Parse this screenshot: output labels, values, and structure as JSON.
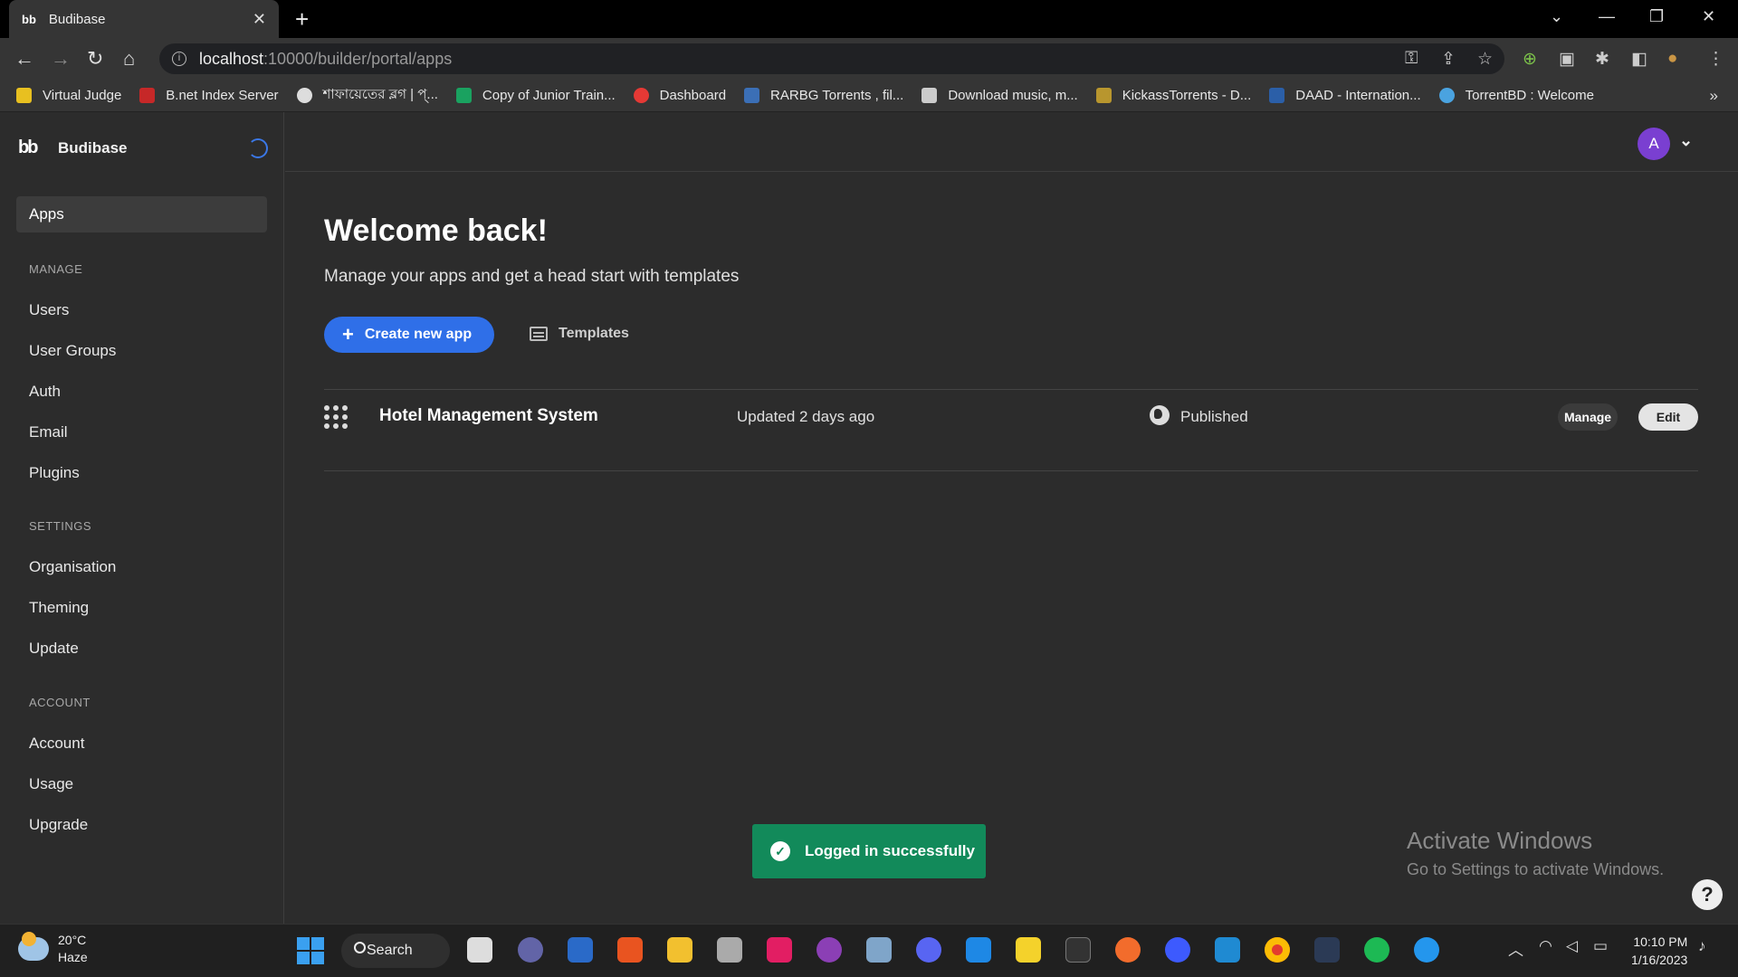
{
  "browser": {
    "tab_title": "Budibase",
    "tab_favicon": "bb",
    "url_host": "localhost",
    "url_path": ":10000/builder/portal/apps",
    "bookmarks": [
      "Virtual Judge",
      "B.net Index Server",
      "শাফায়েতের ব্লগ | প্...",
      "Copy of Junior Train...",
      "Dashboard",
      "RARBG Torrents , fil...",
      "Download music, m...",
      "KickassTorrents - D...",
      "DAAD - Internation...",
      "TorrentBD : Welcome"
    ]
  },
  "sidebar": {
    "brand": "Budibase",
    "active_item": "Apps",
    "manage_header": "MANAGE",
    "manage_items": [
      "Users",
      "User Groups",
      "Auth",
      "Email",
      "Plugins"
    ],
    "settings_header": "SETTINGS",
    "settings_items": [
      "Organisation",
      "Theming",
      "Update"
    ],
    "account_header": "ACCOUNT",
    "account_items": [
      "Account",
      "Usage",
      "Upgrade"
    ]
  },
  "header": {
    "avatar_initial": "A"
  },
  "main": {
    "title": "Welcome back!",
    "subtitle": "Manage your apps and get a head start with templates",
    "create_button": "Create new app",
    "templates_button": "Templates",
    "apps": [
      {
        "name": "Hotel Management System",
        "updated": "Updated 2 days ago",
        "status": "Published",
        "manage_label": "Manage",
        "edit_label": "Edit"
      }
    ]
  },
  "toast": {
    "message": "Logged in successfully",
    "color": "#128a5a"
  },
  "watermark": {
    "line1": "Activate Windows",
    "line2": "Go to Settings to activate Windows."
  },
  "taskbar": {
    "temperature": "20°C",
    "weather": "Haze",
    "search_label": "Search",
    "time": "10:10 PM",
    "date": "1/16/2023"
  },
  "colors": {
    "accent": "#2f6fe8",
    "avatar": "#7a3fd1",
    "background": "#2c2c2c"
  }
}
